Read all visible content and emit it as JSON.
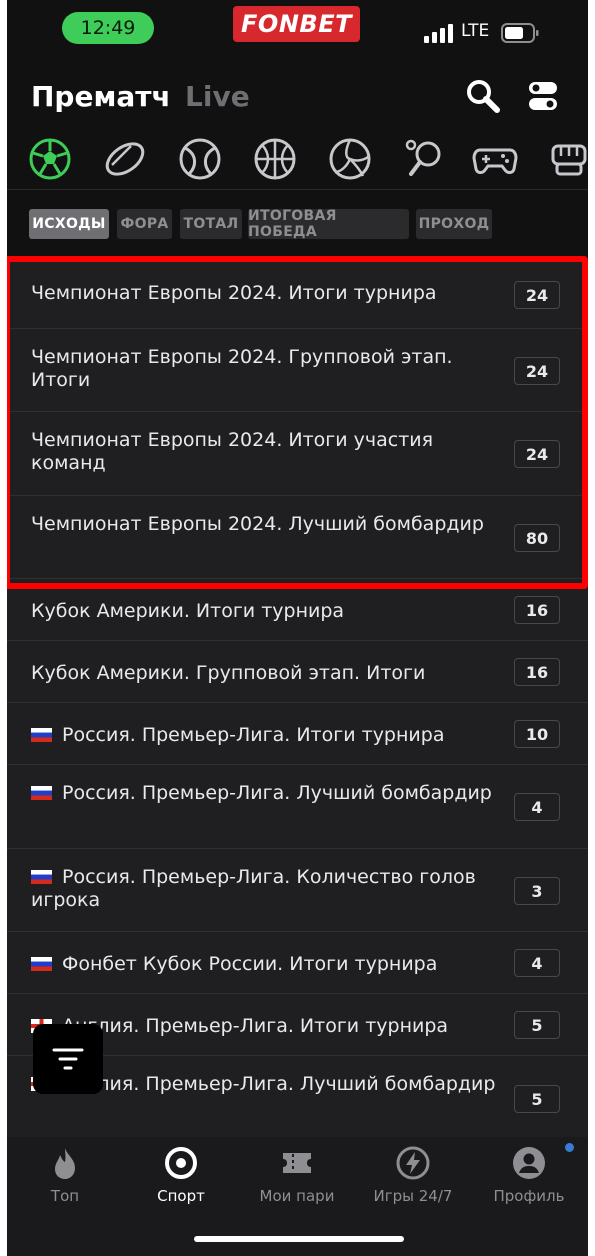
{
  "status_bar": {
    "time": "12:49",
    "network": "LTE",
    "brand": "FONBET"
  },
  "header": {
    "tab_prematch": "Прематч",
    "tab_live": "Live"
  },
  "sports": [
    "football-icon",
    "hockey-icon",
    "tennis-icon",
    "basketball-icon",
    "volleyball-icon",
    "table-tennis-icon",
    "esports-icon",
    "mma-icon"
  ],
  "chips": [
    "ИСХОДЫ",
    "ФОРА",
    "ТОТАЛ",
    "ИТОГОВАЯ ПОБЕДА",
    "ПРОХОД"
  ],
  "rows": [
    {
      "text": "Чемпионат Европы 2024. Итоги турнира",
      "count": "24",
      "flag": ""
    },
    {
      "text": "Чемпионат Европы 2024. Групповой этап. Итоги",
      "count": "24",
      "flag": ""
    },
    {
      "text": "Чемпионат Европы 2024. Итоги участия команд",
      "count": "24",
      "flag": ""
    },
    {
      "text": "Чемпионат Европы 2024. Лучший бомбардир",
      "count": "80",
      "flag": ""
    },
    {
      "text": "Кубок Америки. Итоги турнира",
      "count": "16",
      "flag": ""
    },
    {
      "text": "Кубок Америки. Групповой этап. Итоги",
      "count": "16",
      "flag": ""
    },
    {
      "text": "Россия. Премьер-Лига. Итоги турнира",
      "count": "10",
      "flag": "ru"
    },
    {
      "text": "Россия. Премьер-Лига. Лучший бомбардир",
      "count": "4",
      "flag": "ru"
    },
    {
      "text": "Россия. Премьер-Лига. Количество голов игрока",
      "count": "3",
      "flag": "ru"
    },
    {
      "text": "Фонбет Кубок России. Итоги турнира",
      "count": "4",
      "flag": "ru"
    },
    {
      "text": "Англия. Премьер-Лига. Итоги турнира",
      "count": "5",
      "flag": "en"
    },
    {
      "text": "Англия. Премьер-Лига. Лучший бомбардир",
      "count": "5",
      "flag": "en"
    }
  ],
  "nav": [
    {
      "label": "Топ",
      "icon": "fire-icon"
    },
    {
      "label": "Спорт",
      "icon": "sport-icon"
    },
    {
      "label": "Мои пари",
      "icon": "ticket-icon"
    },
    {
      "label": "Игры 24/7",
      "icon": "lightning-icon"
    },
    {
      "label": "Профиль",
      "icon": "profile-icon"
    }
  ],
  "colors": {
    "accent_green": "#3dcd58",
    "brand_red": "#d7282d",
    "highlight": "#ff0000"
  }
}
